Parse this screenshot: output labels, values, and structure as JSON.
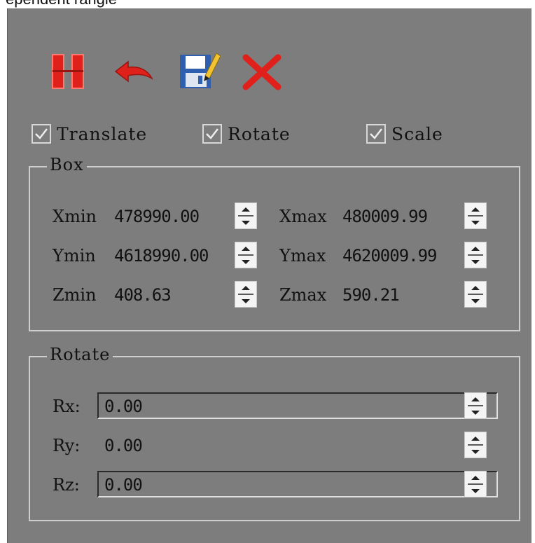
{
  "header": {
    "title": "ependent rangle"
  },
  "toolbar": {
    "pause_icon": "pause-icon",
    "undo_icon": "undo-icon",
    "save_icon": "save-icon",
    "close_icon": "close-icon"
  },
  "options": {
    "translate": {
      "label": "Translate",
      "checked": true
    },
    "rotate": {
      "label": "Rotate",
      "checked": true
    },
    "scale": {
      "label": "Scale",
      "checked": true
    }
  },
  "box": {
    "title": "Box",
    "xmin_label": "Xmin",
    "xmin": "478990.00",
    "xmax_label": "Xmax",
    "xmax": "480009.99",
    "ymin_label": "Ymin",
    "ymin": "4618990.00",
    "ymax_label": "Ymax",
    "ymax": "4620009.99",
    "zmin_label": "Zmin",
    "zmin": "408.63",
    "zmax_label": "Zmax",
    "zmax": "590.21"
  },
  "rotate_group": {
    "title": "Rotate",
    "rx_label": "Rx:",
    "rx": "0.00",
    "ry_label": "Ry:",
    "ry": "0.00",
    "rz_label": "Rz:",
    "rz": "0.00"
  },
  "colors": {
    "panel": "#7d7d7d",
    "icon_red": "#e0201a",
    "border": "#cfcfcf"
  }
}
